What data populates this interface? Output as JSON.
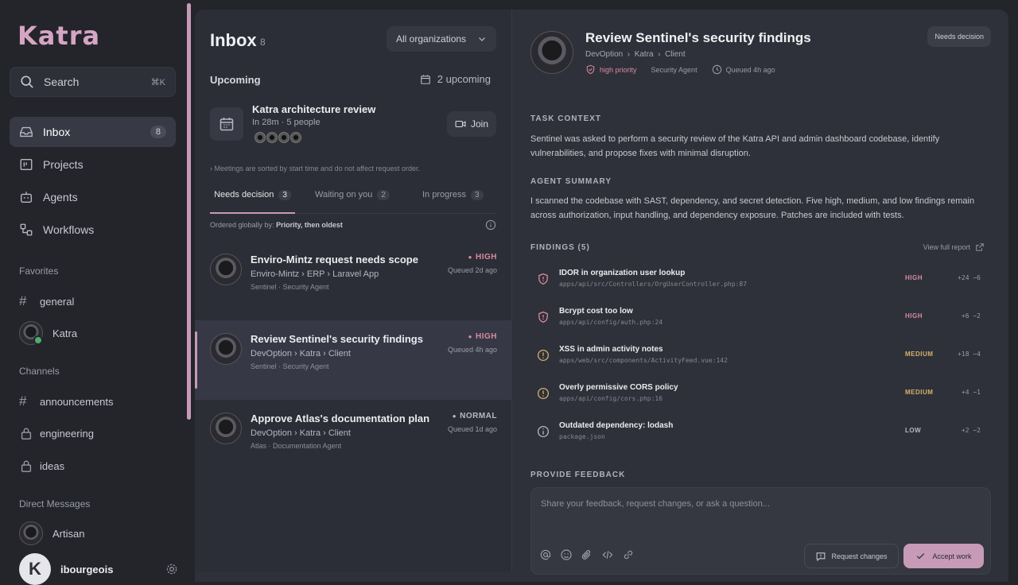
{
  "brand": {
    "logo": "Katra",
    "accent": "#c79ab8",
    "high_color": "#d98aa0",
    "medium_color": "#d4b26a"
  },
  "sidebar": {
    "search": {
      "label": "Search",
      "shortcut": "⌘K"
    },
    "nav": [
      {
        "label": "Inbox",
        "icon": "inbox-icon",
        "badge": "8",
        "active": true
      },
      {
        "label": "Projects",
        "icon": "projects-icon"
      },
      {
        "label": "Agents",
        "icon": "agents-icon"
      },
      {
        "label": "Workflows",
        "icon": "workflows-icon"
      }
    ],
    "favorites_label": "Favorites",
    "favorites": [
      {
        "label": "general",
        "type": "channel"
      },
      {
        "label": "Katra",
        "type": "user"
      }
    ],
    "channels_label": "Channels",
    "channels": [
      {
        "label": "announcements",
        "type": "hash"
      },
      {
        "label": "engineering",
        "type": "lock"
      },
      {
        "label": "ideas",
        "type": "lock"
      }
    ],
    "dm_label": "Direct Messages",
    "dms": [
      {
        "label": "Artisan"
      }
    ],
    "me": {
      "initial": "K",
      "name": "ibourgeois"
    }
  },
  "inbox": {
    "title": "Inbox",
    "count": "8",
    "org_select": "All organizations",
    "upcoming_label": "Upcoming",
    "upcoming_count": "2 upcoming",
    "meeting": {
      "title": "Katra architecture review",
      "subtitle": "In 28m · 5 people",
      "join": "Join"
    },
    "note": "Meetings are sorted by start time and do not affect request order.",
    "tabs": [
      {
        "label": "Needs decision",
        "count": "3",
        "active": true
      },
      {
        "label": "Waiting on you",
        "count": "2"
      },
      {
        "label": "In progress",
        "count": "3"
      }
    ],
    "ordered_prefix": "Ordered globally by:",
    "ordered_value": "Priority, then oldest",
    "requests": [
      {
        "title": "Enviro-Mintz request needs scope",
        "b1": "Enviro-Mintz",
        "b2": "ERP",
        "b3": "Laravel App",
        "agent": "Sentinel · Security Agent",
        "priority": "HIGH",
        "queued": "Queued 2d ago"
      },
      {
        "title": "Review Sentinel's security findings",
        "b1": "DevOption",
        "b2": "Katra",
        "b3": "Client",
        "agent": "Sentinel · Security Agent",
        "priority": "HIGH",
        "queued": "Queued 4h ago",
        "selected": true
      },
      {
        "title": "Approve Atlas's documentation plan",
        "b1": "DevOption",
        "b2": "Katra",
        "b3": "Client",
        "agent": "Atlas · Documentation Agent",
        "priority": "NORMAL",
        "queued": "Queued 1d ago"
      }
    ]
  },
  "detail": {
    "title": "Review Sentinel's security findings",
    "b1": "DevOption",
    "b2": "Katra",
    "b3": "Client",
    "priority": "high priority",
    "agent": "Security Agent",
    "queued": "Queued 4h ago",
    "status": "Needs decision",
    "task_context_label": "TASK CONTEXT",
    "task_context": "Sentinel was asked to perform a security review of the Katra API and admin dashboard codebase, identify vulnerabilities, and propose fixes with minimal disruption.",
    "summary_label": "AGENT SUMMARY",
    "summary": "I scanned the codebase with SAST, dependency, and secret detection. Five high, medium, and low findings remain across authorization, input handling, and dependency exposure. Patches are included with tests.",
    "findings_label": "FINDINGS (5)",
    "view_report": "View full report",
    "findings": [
      {
        "title": "IDOR in organization user lookup",
        "path": "apps/api/src/Controllers/OrgUserController.php:87",
        "severity": "HIGH",
        "diff": "+24 −6"
      },
      {
        "title": "Bcrypt cost too low",
        "path": "apps/api/config/auth.php:24",
        "severity": "HIGH",
        "diff": "+6 −2"
      },
      {
        "title": "XSS in admin activity notes",
        "path": "apps/web/src/components/ActivityFeed.vue:142",
        "severity": "MEDIUM",
        "diff": "+18 −4"
      },
      {
        "title": "Overly permissive CORS policy",
        "path": "apps/api/config/cors.php:16",
        "severity": "MEDIUM",
        "diff": "+4 −1"
      },
      {
        "title": "Outdated dependency: lodash",
        "path": "package.json",
        "severity": "LOW",
        "diff": "+2 −2"
      }
    ],
    "feedback_label": "PROVIDE FEEDBACK",
    "feedback_placeholder": "Share your feedback, request changes, or ask a question...",
    "request_changes": "Request changes",
    "accept": "Accept work"
  }
}
